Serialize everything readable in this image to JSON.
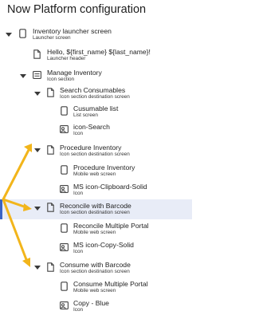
{
  "header": {
    "title": "Now Platform configuration"
  },
  "tree": [
    {
      "id": "inventory-launcher-screen",
      "label": "Inventory launcher screen",
      "sub": "Launcher screen",
      "icon": "mobile-phone-icon",
      "expanded": true
    },
    {
      "id": "launcher-header",
      "label": "Hello, ${first_name} ${last_name}!",
      "sub": "Launcher header",
      "icon": "document-icon"
    },
    {
      "id": "manage-inventory",
      "label": "Manage Inventory",
      "sub": "Icon section",
      "icon": "icon-section-icon",
      "expanded": true
    },
    {
      "id": "search-consumables",
      "label": "Search Consumables",
      "sub": "Icon section destination screen",
      "icon": "document-icon",
      "expanded": true
    },
    {
      "id": "cusumable-list",
      "label": "Cusumable list",
      "sub": "List screen",
      "icon": "mobile-phone-icon"
    },
    {
      "id": "icon-search",
      "label": "icon-Search",
      "sub": "Icon",
      "icon": "image-icon"
    },
    {
      "id": "procedure-inventory",
      "label": "Procedure Inventory",
      "sub": "Icon section destination screen",
      "icon": "document-icon",
      "expanded": true
    },
    {
      "id": "procedure-inventory-mobile",
      "label": "Procedure Inventory",
      "sub": "Mobile web screen",
      "icon": "mobile-phone-icon"
    },
    {
      "id": "ms-icon-clipboard-solid",
      "label": "MS icon-Clipboard-Solid",
      "sub": "Icon",
      "icon": "image-icon"
    },
    {
      "id": "reconcile-with-barcode",
      "label": "Reconcile with Barcode",
      "sub": "Icon section destination screen",
      "icon": "document-icon",
      "expanded": true,
      "selected": true
    },
    {
      "id": "reconcile-multiple-portal",
      "label": "Reconcile Multiple Portal",
      "sub": "Mobile web screen",
      "icon": "mobile-phone-icon"
    },
    {
      "id": "ms-icon-copy-solid",
      "label": "MS icon-Copy-Solid",
      "sub": "Icon",
      "icon": "image-icon"
    },
    {
      "id": "consume-with-barcode",
      "label": "Consume with Barcode",
      "sub": "Icon section destination screen",
      "icon": "document-icon",
      "expanded": true
    },
    {
      "id": "consume-multiple-portal",
      "label": "Consume Multiple Portal",
      "sub": "Mobile web screen",
      "icon": "mobile-phone-icon"
    },
    {
      "id": "copy-blue",
      "label": "Copy - Blue",
      "sub": "Icon",
      "icon": "image-icon"
    }
  ],
  "colors": {
    "annotation_arrows": "#f2b51b",
    "selected_row": "#e8ecf7",
    "selected_accent": "#3a63c4"
  }
}
